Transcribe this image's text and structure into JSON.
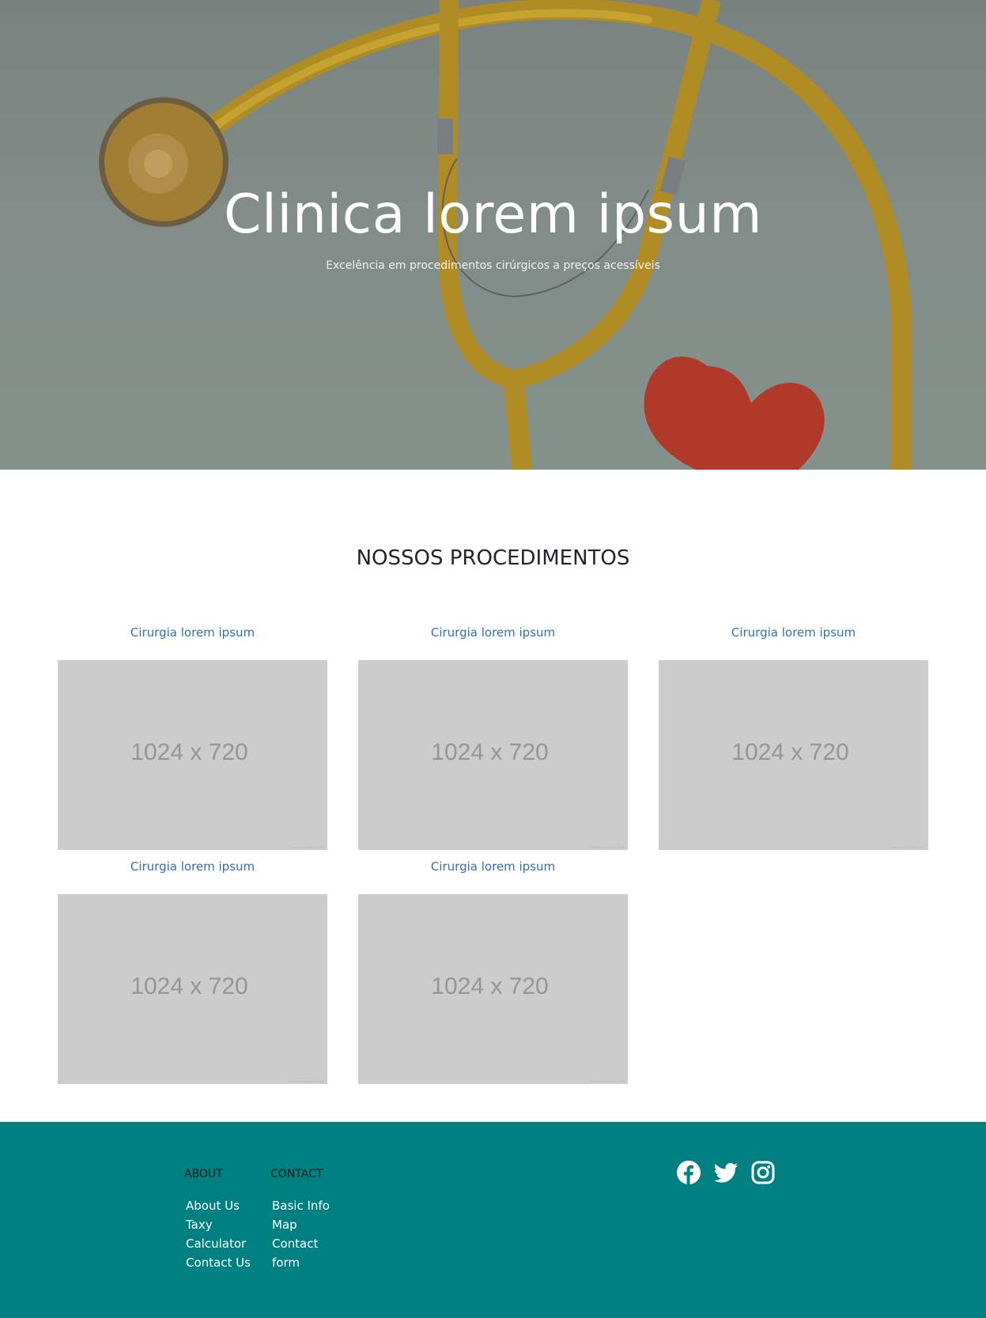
{
  "hero": {
    "title": "Clinica lorem ipsum",
    "subtitle": "Excelência em procedimentos cirúrgicos a preços acessíveis"
  },
  "procedures": {
    "title": "NOSSOS PROCEDIMENTOS",
    "items": [
      {
        "title": "Cirurgia lorem ipsum",
        "image_text": "1024 x 720",
        "image_credit": "Powered by HTML.COM"
      },
      {
        "title": "Cirurgia lorem ipsum",
        "image_text": "1024 x 720",
        "image_credit": "Powered by HTML.COM"
      },
      {
        "title": "Cirurgia lorem ipsum",
        "image_text": "1024 x 720",
        "image_credit": "Powered by HTML.COM"
      },
      {
        "title": "Cirurgia lorem ipsum",
        "image_text": "1024 x 720",
        "image_credit": "Powered by HTML.COM"
      },
      {
        "title": "Cirurgia lorem ipsum",
        "image_text": "1024 x 720",
        "image_credit": "Powered by HTML.COM"
      }
    ]
  },
  "footer": {
    "about": {
      "heading": "ABOUT",
      "links": [
        "About Us",
        "Taxy",
        "Calculator",
        "Contact Us"
      ]
    },
    "contact": {
      "heading": "CONTACT",
      "links": [
        "Basic Info",
        "Map",
        "Contact",
        "form"
      ]
    },
    "social": [
      "facebook-icon",
      "twitter-icon",
      "instagram-icon"
    ]
  },
  "colors": {
    "footer_bg": "#008080",
    "link": "#2f6fb7",
    "placeholder_bg": "#cccccc"
  }
}
